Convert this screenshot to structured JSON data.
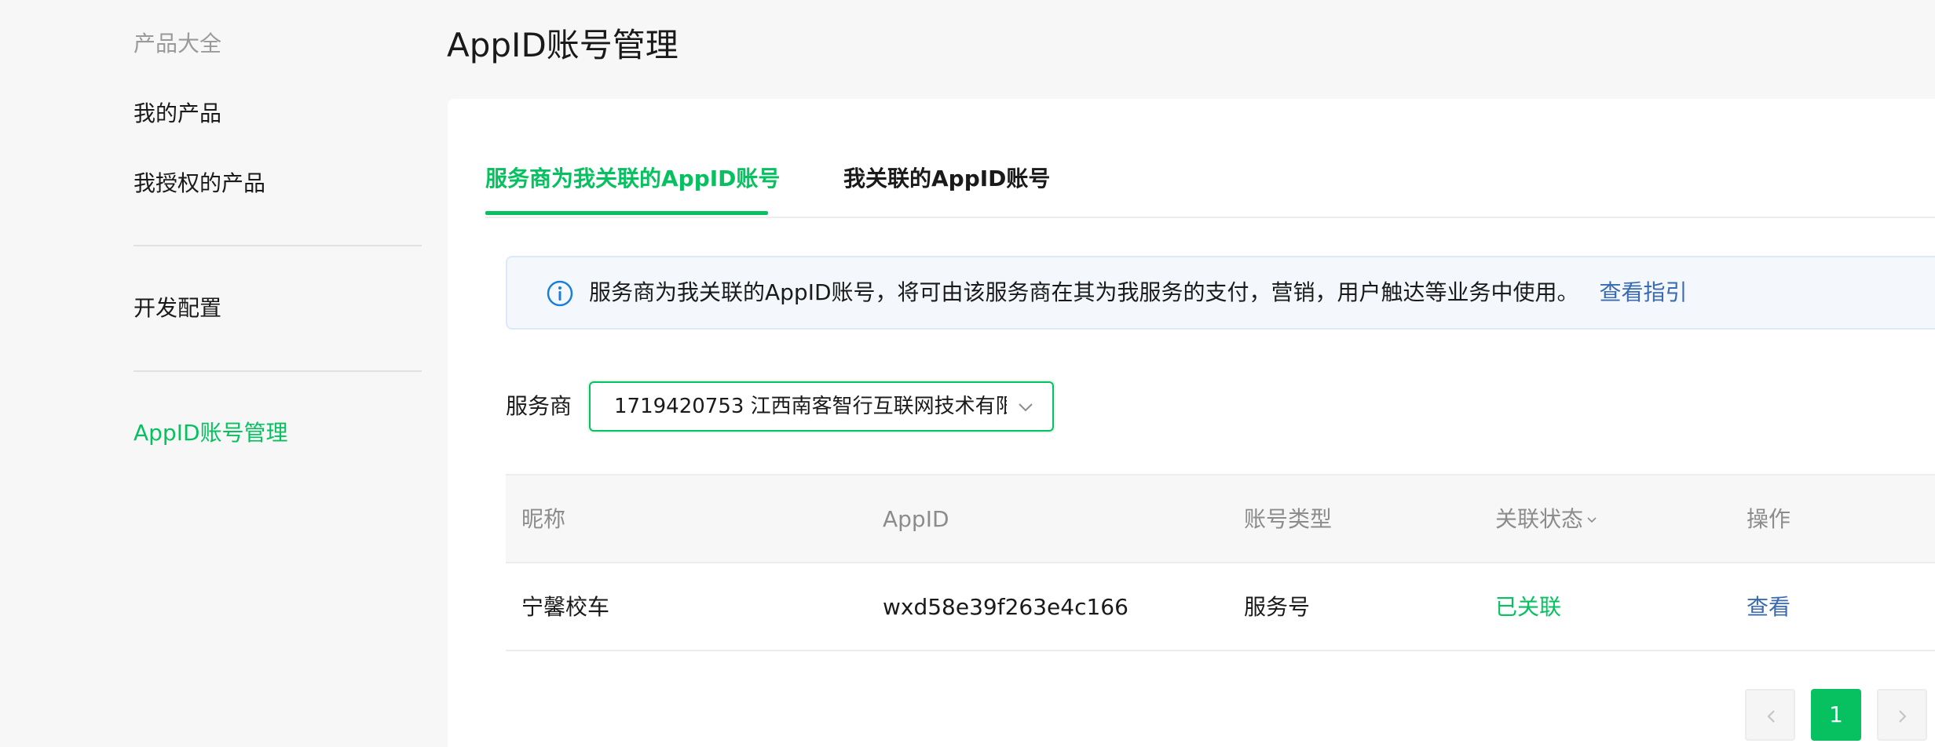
{
  "sidebar": {
    "section_title": "产品大全",
    "items": [
      {
        "label": "我的产品"
      },
      {
        "label": "我授权的产品"
      },
      {
        "label": "开发配置"
      },
      {
        "label": "AppID账号管理"
      }
    ]
  },
  "page": {
    "title": "AppID账号管理"
  },
  "tabs": [
    {
      "label": "服务商为我关联的AppID账号",
      "active": true
    },
    {
      "label": "我关联的AppID账号",
      "active": false
    }
  ],
  "notice": {
    "icon": "info-icon",
    "text": "服务商为我关联的AppID账号，将可由该服务商在其为我服务的支付，营销，用户触达等业务中使用。",
    "link": "查看指引"
  },
  "filter": {
    "label": "服务商",
    "selected": "1719420753   江西南客智行互联网技术有限"
  },
  "table": {
    "headers": [
      "昵称",
      "AppID",
      "账号类型",
      "关联状态",
      "操作"
    ],
    "rows": [
      {
        "nickname": "宁馨校车",
        "appid": "wxd58e39f263e4c166",
        "type": "服务号",
        "status": "已关联",
        "action": "查看"
      }
    ]
  },
  "pagination": {
    "current": "1"
  },
  "colors": {
    "accent": "#07c160",
    "link": "#3a6aaf",
    "info": "#1a7fd9"
  }
}
